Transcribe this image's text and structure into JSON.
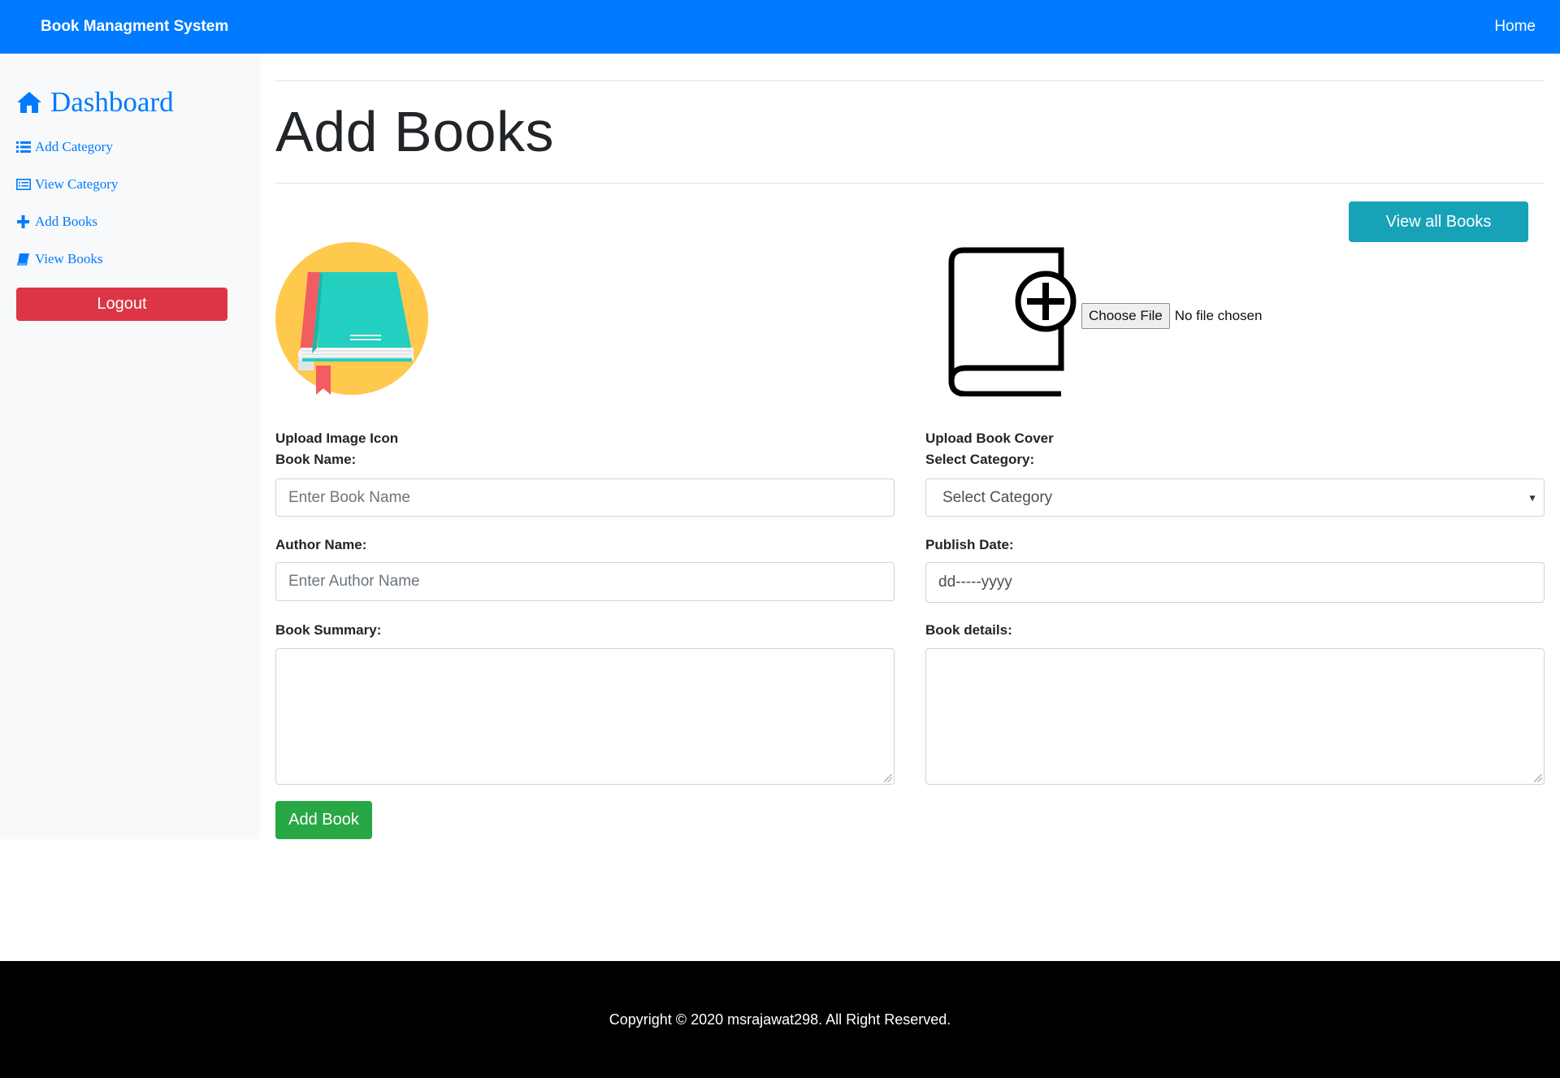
{
  "navbar": {
    "brand": "Book Managment System",
    "home": "Home"
  },
  "sidebar": {
    "dashboard": "Dashboard",
    "items": [
      {
        "label": "Add Category",
        "icon": "list-icon"
      },
      {
        "label": "View Category",
        "icon": "list-alt-icon"
      },
      {
        "label": "Add Books",
        "icon": "plus-icon"
      },
      {
        "label": "View Books",
        "icon": "book-icon"
      }
    ],
    "logout": "Logout"
  },
  "main": {
    "title": "Add Books",
    "view_all": "View all Books",
    "file": {
      "button": "Choose File",
      "status": "No file chosen"
    },
    "upload_icon_label": "Upload Image Icon",
    "upload_cover_label": "Upload Book Cover",
    "book_name": {
      "label": "Book Name:",
      "placeholder": "Enter Book Name"
    },
    "category": {
      "label": "Select Category:",
      "selected": "Select Category"
    },
    "author": {
      "label": "Author Name:",
      "placeholder": "Enter Author Name"
    },
    "publish": {
      "label": "Publish Date:",
      "placeholder": "dd-----yyyy"
    },
    "summary": {
      "label": "Book Summary:"
    },
    "details": {
      "label": "Book details:"
    },
    "submit": "Add Book"
  },
  "footer": {
    "text": "Copyright © 2020 msrajawat298. All Right Reserved."
  },
  "colors": {
    "primary": "#007bff",
    "danger": "#dc3545",
    "info": "#17a2b8",
    "success": "#28a745",
    "footer_bg": "#000000"
  }
}
